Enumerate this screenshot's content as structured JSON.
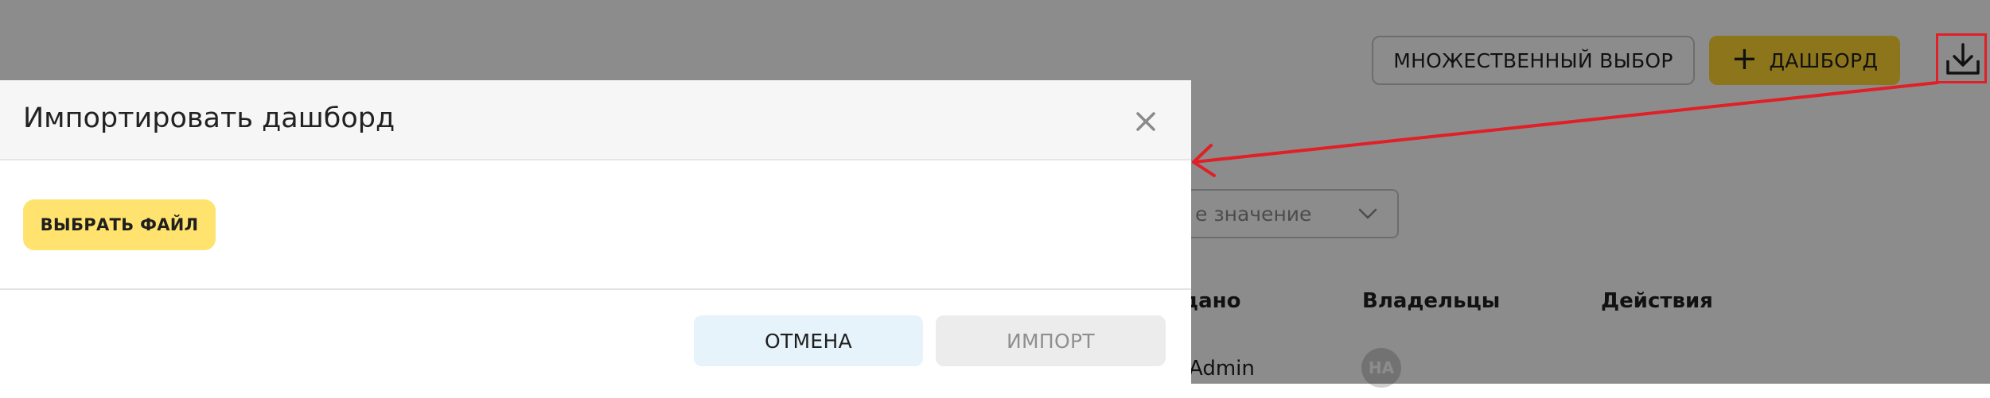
{
  "toolbar": {
    "multi_select_label": "МНОЖЕСТВЕННЫЙ ВЫБОР",
    "add_dashboard_label": "ДАШБОРД",
    "add_dashboard_icon": "plus-icon",
    "import_icon": "download-tray-icon"
  },
  "filters": {
    "select_placeholder": "е значение",
    "select_icon": "chevron-down-icon"
  },
  "table": {
    "columns": [
      "здано",
      "Владельцы",
      "Действия"
    ],
    "rows": [
      {
        "created_by": "Admin",
        "owner_avatar": "НА"
      }
    ]
  },
  "modal": {
    "title": "Импортировать дашборд",
    "close_icon": "close-icon",
    "choose_file_label": "ВЫБРАТЬ ФАЙЛ",
    "cancel_label": "ОТМЕНА",
    "import_label": "ИМПОРТ"
  },
  "annotation": {
    "color": "#e01f26"
  },
  "colors": {
    "primary_yellow": "#ffd632",
    "light_yellow": "#ffe36e",
    "cancel_bg": "#e6f3fb",
    "disabled_bg": "#ececec"
  }
}
